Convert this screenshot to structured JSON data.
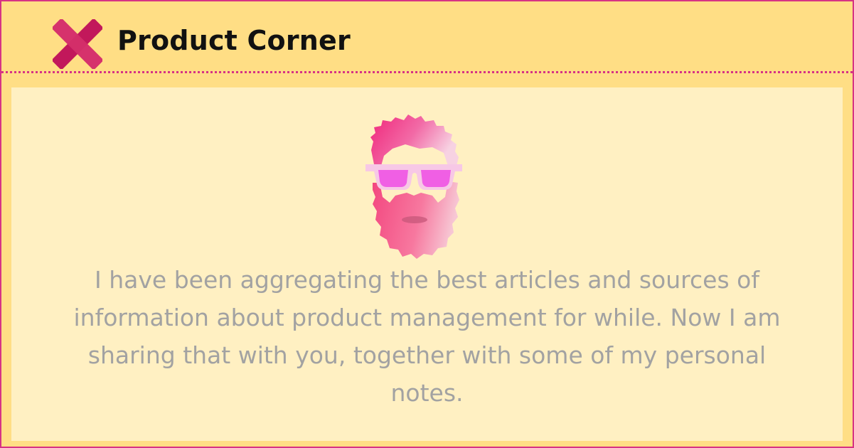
{
  "header": {
    "brand_name": "Product Corner",
    "logo_icon": "x-cross-logo-icon"
  },
  "hero": {
    "avatar_icon": "bearded-man-sunglasses-avatar-icon",
    "intro_text": "I have been aggregating the best articles and sources of information about product management for while. Now I am sharing that with you, together with some of my personal notes."
  },
  "colors": {
    "accent": "#d63384",
    "header_background": "#ffde85",
    "panel_background": "#fff0c2",
    "body_text": "#a2a2a2",
    "brand_text": "#111111"
  }
}
